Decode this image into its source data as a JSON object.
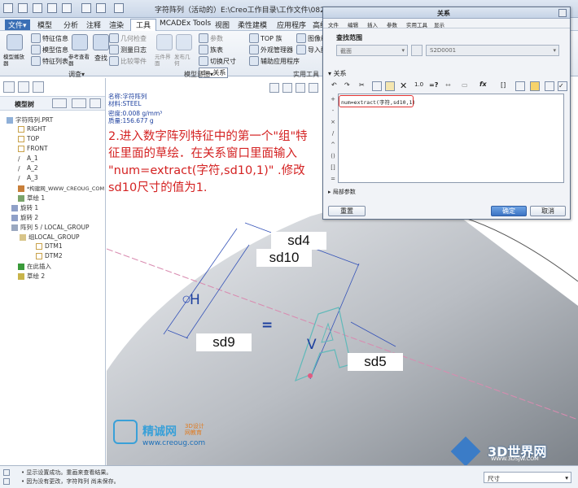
{
  "window": {
    "title": "字符阵列（活动的）E:\\Creo工作目录\\工作文件\\0829\\"
  },
  "menu": {
    "tabs": [
      "文件▾",
      "模型",
      "分析",
      "注释",
      "渲染",
      "工具",
      "MCADEx Tools",
      "视图",
      "柔性建模",
      "应用程序",
      "高级"
    ],
    "active": "工具"
  },
  "ribbon": {
    "buttons": [
      "模型播放器",
      "特征信息",
      "模型信息",
      "特征列表",
      "参考查看器",
      "查找",
      "几何检查",
      "测量日志",
      "比较零件",
      "元件界面",
      "发布几何",
      "参数",
      "族表",
      "切换尺寸",
      "d= 关系",
      "TOP 族",
      "外观管理器",
      "辅助应用程序",
      "图像编辑",
      "导入配置"
    ],
    "groups": [
      "调查▾",
      "模型意图▾",
      "实用工具"
    ]
  },
  "left_panel": {
    "header": "模型树",
    "tree": [
      "字符阵列.PRT",
      "RIGHT",
      "TOP",
      "FRONT",
      "A_1",
      "A_2",
      "A_3",
      "*构建网_WWW_CREOUG_COM",
      "草绘 1",
      "旋转 1",
      "旋转 2",
      "阵列 5 / LOCAL_GROUP",
      "组LOCAL_GROUP",
      "DTM1",
      "DTM2",
      "在此插入",
      "草绘 2"
    ]
  },
  "model_info": {
    "name": "名称:字符阵列",
    "material": "材料:STEEL",
    "density": "密度:0.008 g/mm³",
    "mass": "质量:156.677 g"
  },
  "instruction": {
    "line1": "2.进入数字阵列特征中的第一个\"组\"特",
    "line2": "征里面的草绘．在关系窗口里面输入",
    "line3": "\"num=extract(字符,sd10,1)\" .修改",
    "line4": "sd10尺寸的值为1."
  },
  "dimensions": {
    "sd4": "sd4",
    "sd10": "sd10",
    "sd9": "sd9",
    "sd5": "sd5",
    "h": "H",
    "v": "V",
    "eq": "="
  },
  "dialog": {
    "title": "关系",
    "menu": [
      "文件",
      "编辑",
      "插入",
      "参数",
      "实用工具",
      "显示"
    ],
    "scope_label": "查找范围",
    "scope_value": "截面",
    "sketch_value": "S2D0001",
    "relations_label": "关系",
    "relation_text": "num=extract(字符,sd10,1)",
    "local_params": "局部参数",
    "reset_button": "重置",
    "ok_button": "确定",
    "cancel_button": "取消"
  },
  "status": {
    "line1": "• 显示设置成功。重画来查看结果。",
    "line2": "• 因为没有更改，字符阵列 尚未保存。",
    "right_label": "尺寸"
  },
  "watermarks": {
    "site_cn": "精诚网",
    "sub_cn": "3D设计\n网教育",
    "url": "www.creoug.com",
    "brand": "3D世界网",
    "brand_url": "WWW.3DSJW.COM"
  }
}
